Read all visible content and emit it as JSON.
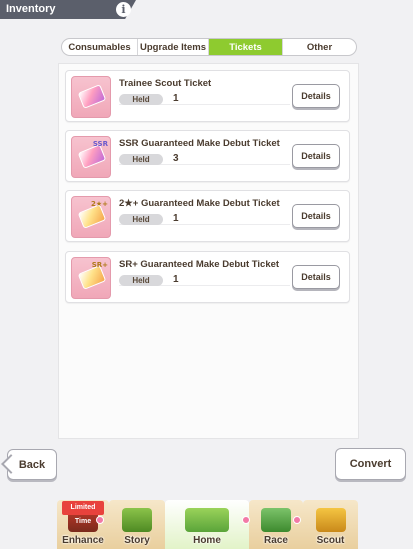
{
  "header": {
    "title": "Inventory",
    "info_icon": "info-icon"
  },
  "tabs": [
    {
      "label": "Consumables",
      "active": false
    },
    {
      "label": "Upgrade Items",
      "active": false
    },
    {
      "label": "Tickets",
      "active": true
    },
    {
      "label": "Other",
      "active": false
    }
  ],
  "tickets": [
    {
      "name": "Trainee Scout Ticket",
      "held_label": "Held",
      "held": "1",
      "details_label": "Details",
      "tag": ""
    },
    {
      "name": "SSR Guaranteed Make Debut Ticket",
      "held_label": "Held",
      "held": "3",
      "details_label": "Details",
      "tag": "SSR"
    },
    {
      "name": "2★+ Guaranteed Make Debut Ticket",
      "held_label": "Held",
      "held": "1",
      "details_label": "Details",
      "tag": "2★+"
    },
    {
      "name": "SR+ Guaranteed Make Debut Ticket",
      "held_label": "Held",
      "held": "1",
      "details_label": "Details",
      "tag": "SR+"
    }
  ],
  "buttons": {
    "back": "Back",
    "convert": "Convert"
  },
  "nav": {
    "items": [
      {
        "label": "Enhance"
      },
      {
        "label": "Story"
      },
      {
        "label": "Home"
      },
      {
        "label": "Race"
      },
      {
        "label": "Scout"
      }
    ],
    "limited_badge": "Limited Time"
  },
  "colors": {
    "active_tab": "#8ecb2f",
    "header_bg": "#5b5f6b",
    "text": "#4a3b2e"
  }
}
